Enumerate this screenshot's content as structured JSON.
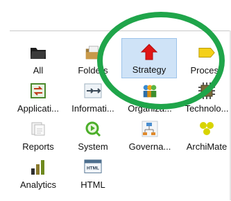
{
  "tiles": [
    {
      "label": "All",
      "icon": "folder-icon",
      "selected": false
    },
    {
      "label": "Folders",
      "icon": "folder-stack-icon",
      "selected": false
    },
    {
      "label": "Strategy",
      "icon": "strategy-arrow-icon",
      "selected": true
    },
    {
      "label": "Process",
      "icon": "process-arrow-icon",
      "selected": false
    },
    {
      "label": "Applicati...",
      "icon": "application-icon",
      "selected": false
    },
    {
      "label": "Informati...",
      "icon": "information-icon",
      "selected": false
    },
    {
      "label": "Organiza...",
      "icon": "organization-icon",
      "selected": false
    },
    {
      "label": "Technolo...",
      "icon": "technology-icon",
      "selected": false
    },
    {
      "label": "Reports",
      "icon": "reports-icon",
      "selected": false
    },
    {
      "label": "System",
      "icon": "system-icon",
      "selected": false
    },
    {
      "label": "Governa...",
      "icon": "governance-icon",
      "selected": false
    },
    {
      "label": "ArchiMate",
      "icon": "archimate-icon",
      "selected": false
    },
    {
      "label": "Analytics",
      "icon": "analytics-icon",
      "selected": false
    },
    {
      "label": "HTML",
      "icon": "html-icon",
      "selected": false
    }
  ],
  "colors": {
    "selection": "#cfe3f7",
    "highlight_ring": "#1fa54a",
    "strategy_red": "#e01616"
  }
}
